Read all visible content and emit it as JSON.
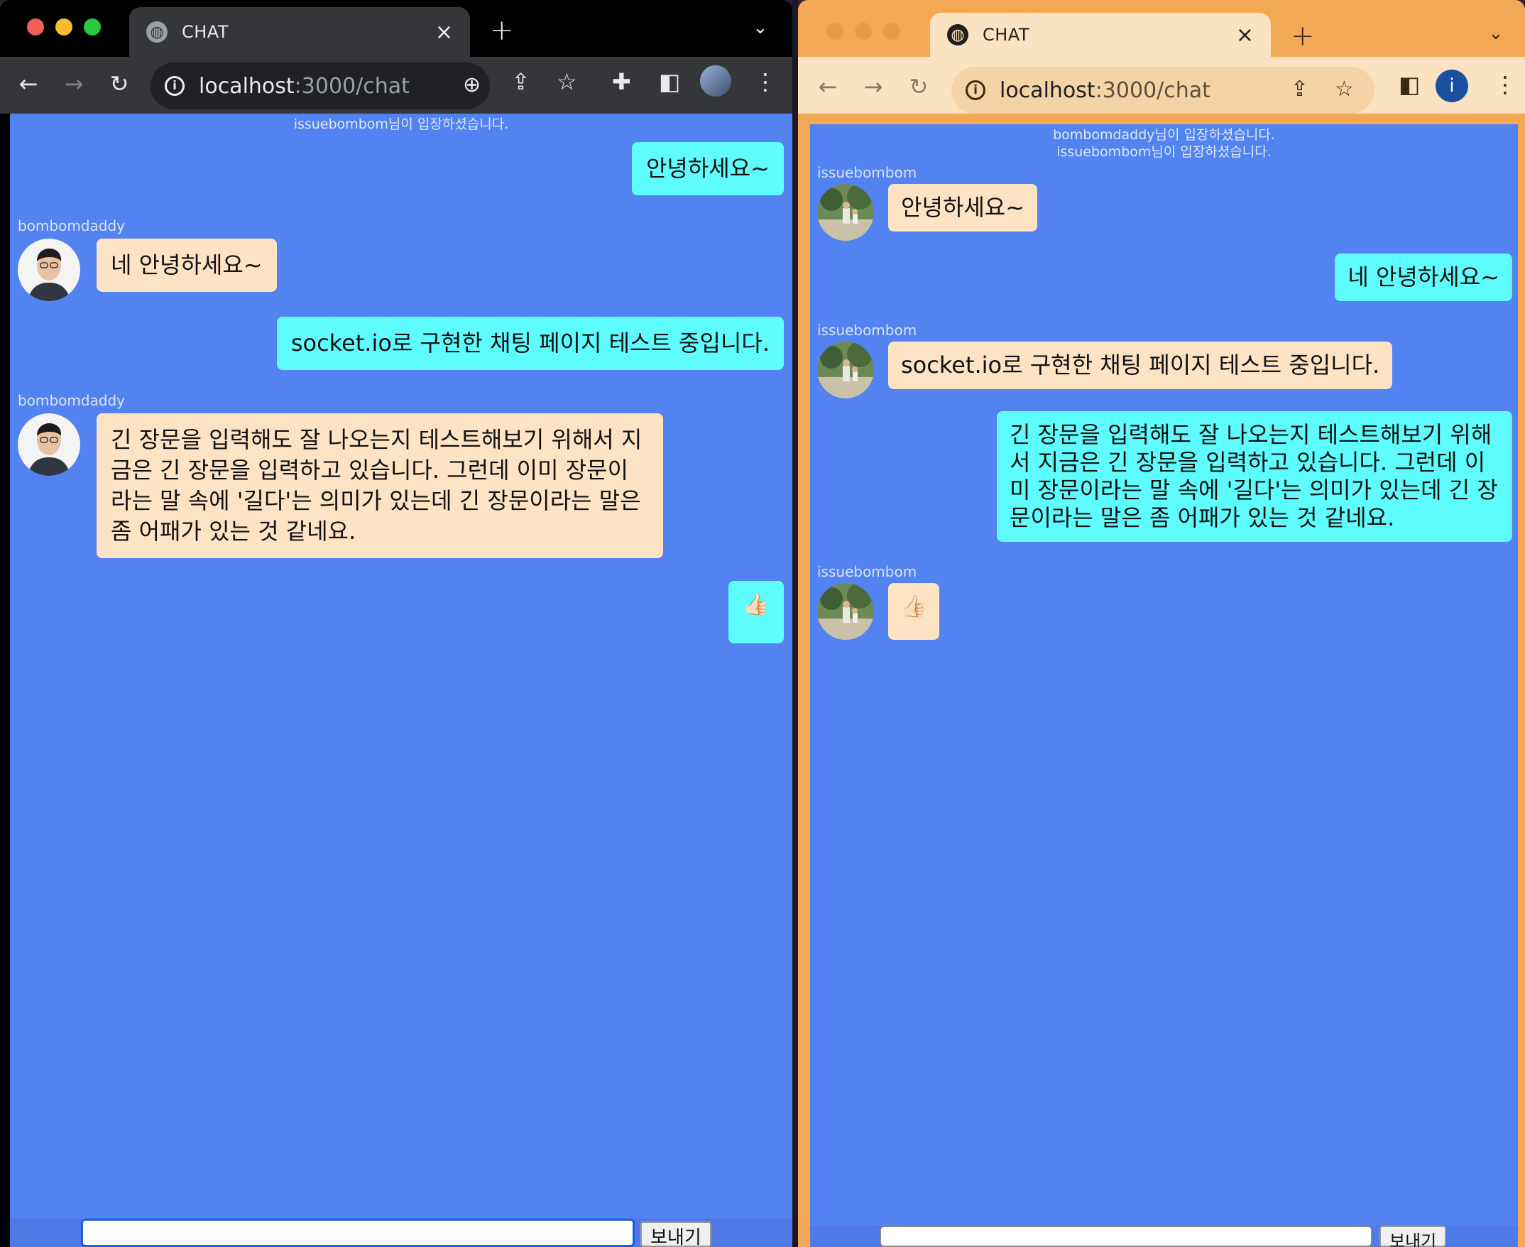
{
  "left_window": {
    "tab_title": "CHAT",
    "url_host": "localhost",
    "url_path": ":3000/chat",
    "system_messages": [
      "issuebombom님이 입장하셨습니다."
    ],
    "messages": [
      {
        "direction": "out",
        "text": "안녕하세요~"
      },
      {
        "direction": "in",
        "user": "bombomdaddy",
        "text": "네 안녕하세요~"
      },
      {
        "direction": "out",
        "text": "socket.io로 구현한 채팅 페이지 테스트 중입니다."
      },
      {
        "direction": "in",
        "user": "bombomdaddy",
        "text": "긴 장문을 입력해도 잘 나오는지 테스트해보기 위해서 지금은 긴 장문을 입력하고 있습니다. 그런데 이미 장문이라는 말 속에 '길다'는 의미가 있는데 긴 장문이라는 말은 좀 어패가 있는 것 같네요."
      },
      {
        "direction": "out",
        "text": "👍🏻"
      }
    ],
    "input_value": "",
    "send_label": "보내기"
  },
  "right_window": {
    "tab_title": "CHAT",
    "url_host": "localhost",
    "url_path": ":3000/chat",
    "profile_initial": "i",
    "system_messages": [
      "bombomdaddy님이 입장하셨습니다.",
      "issuebombom님이 입장하셨습니다."
    ],
    "messages": [
      {
        "direction": "in",
        "user": "issuebombom",
        "text": "안녕하세요~"
      },
      {
        "direction": "out",
        "text": "네 안녕하세요~"
      },
      {
        "direction": "in",
        "user": "issuebombom",
        "text": "socket.io로 구현한 채팅 페이지 테스트 중입니다."
      },
      {
        "direction": "out",
        "text": "긴 장문을 입력해도 잘 나오는지 테스트해보기 위해서 지금은 긴 장문을 입력하고 있습니다. 그런데 이미 장문이라는 말 속에 '길다'는 의미가 있는데 긴 장문이라는 말은 좀 어패가 있는 것 같네요."
      },
      {
        "direction": "in",
        "user": "issuebombom",
        "text": "👍🏻"
      }
    ],
    "input_value": "",
    "send_label": "보내기"
  },
  "icons": [
    "globe-icon",
    "close-icon",
    "plus-icon",
    "chevron-down-icon",
    "back-icon",
    "forward-icon",
    "reload-icon",
    "info-icon",
    "zoom-icon",
    "share-icon",
    "star-icon",
    "extensions-icon",
    "sidepanel-icon",
    "profile-icon",
    "more-icon"
  ],
  "colors": {
    "chat_background": "#5283f1",
    "incoming_bubble": "#fde3c3",
    "outgoing_bubble": "#5ffcfd",
    "left_frame": "#000000",
    "right_frame": "#f2a854"
  }
}
